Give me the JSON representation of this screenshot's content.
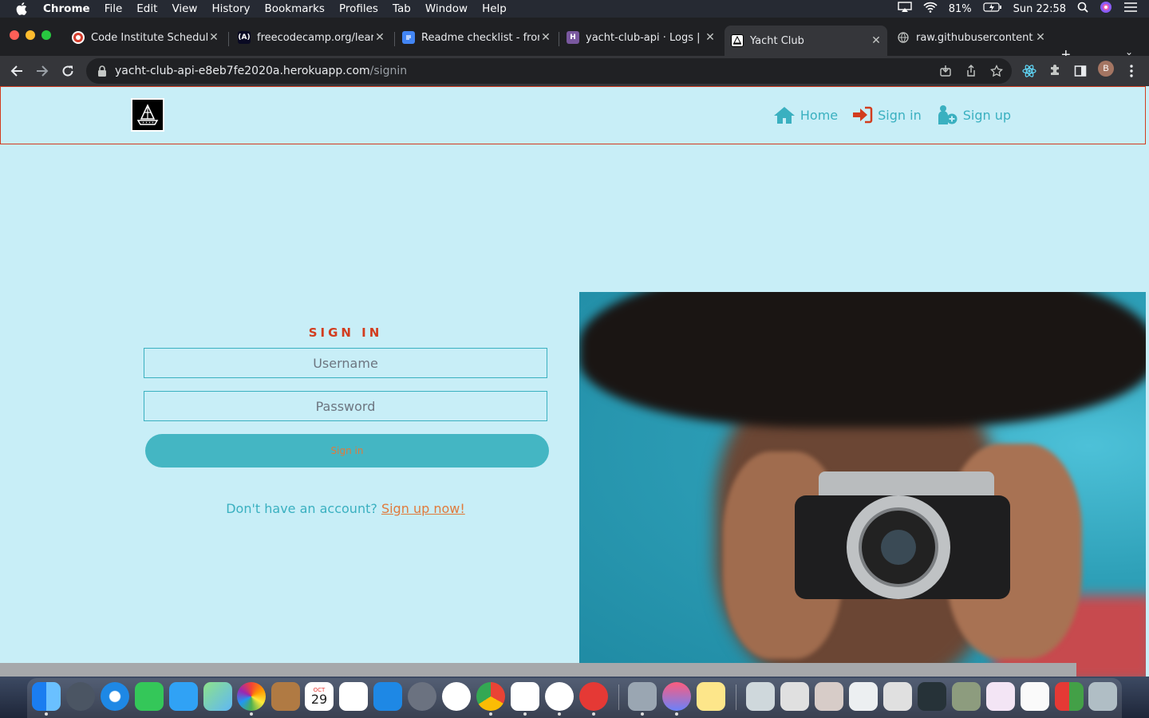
{
  "menubar": {
    "app": "Chrome",
    "items": [
      "File",
      "Edit",
      "View",
      "History",
      "Bookmarks",
      "Profiles",
      "Tab",
      "Window",
      "Help"
    ],
    "battery": "81%",
    "clock": "Sun 22:58"
  },
  "tabs": [
    {
      "label": "Code Institute Schedule",
      "icon": "code-institute-icon"
    },
    {
      "label": "freecodecamp.org/learn/",
      "icon": "freecodecamp-icon"
    },
    {
      "label": "Readme checklist - front",
      "icon": "google-docs-icon"
    },
    {
      "label": "yacht-club-api · Logs | H",
      "icon": "heroku-icon"
    },
    {
      "label": "Yacht Club",
      "icon": "yacht-club-icon",
      "active": true
    },
    {
      "label": "raw.githubusercontent.c",
      "icon": "globe-icon"
    }
  ],
  "address": {
    "host": "yacht-club-api-e8eb7fe2020a.herokuapp.com",
    "path": "/signin"
  },
  "profile_initial": "B",
  "nav": {
    "home": "Home",
    "signin": "Sign in",
    "signup": "Sign up"
  },
  "form": {
    "title": "SIGN IN",
    "username_placeholder": "Username",
    "password_placeholder": "Password",
    "submit": "Sign in",
    "no_account": "Don't have an account?",
    "signup_link": "Sign up now!"
  },
  "dock": {
    "calendar_month": "OCT",
    "calendar_day": "29"
  },
  "colors": {
    "page_bg": "#c8eef7",
    "accent_teal": "#3ab0c0",
    "accent_red": "#d23c1e",
    "accent_orange": "#e07a3c"
  }
}
